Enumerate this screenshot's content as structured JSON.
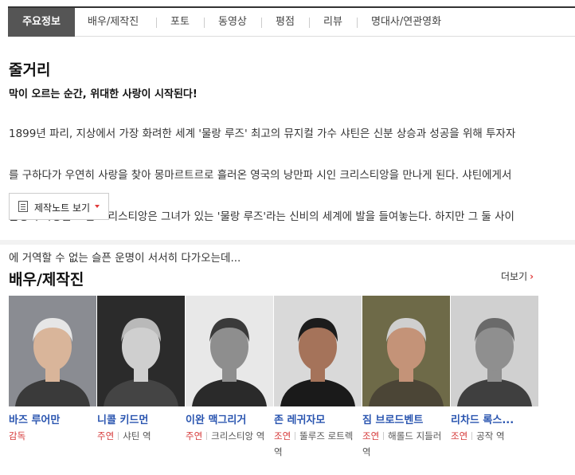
{
  "tabs": [
    "주요정보",
    "배우/제작진",
    "포토",
    "동영상",
    "평점",
    "리뷰",
    "명대사/연관영화"
  ],
  "synopsis": {
    "heading": "줄거리",
    "tagline": "막이 오르는 순간, 위대한 사랑이 시작된다!",
    "lines": [
      "1899년 파리, 지상에서 가장 화려한 세계 '물랑 루즈' 최고의 뮤지컬 가수 샤틴은 신분 상승과 성공을 위해 투자자",
      "를 구하다가 우연히 사랑을 찾아 몽마르트르로 흘러온 영국의 낭만파 시인 크리스티앙을 만나게 된다. 샤틴에게서",
      "운명적 사랑을 느낀 크리스티앙은 그녀가 있는 '물랑 루즈'라는 신비의 세계에 발을 들여놓는다. 하지만 그 둘 사이",
      "에 거역할 수 없는 슬픈 운명이 서서히 다가오는데..."
    ],
    "notes_button": "제작노트 보기"
  },
  "cast_section": {
    "heading": "배우/제작진",
    "more": "더보기"
  },
  "cast": [
    {
      "name": "바즈 루어만",
      "role_type": "감독",
      "role_name": "",
      "photo_icon": "portrait-icon",
      "bg": "#8a8c92",
      "skin": "#d9b59a",
      "hair": "#e6e6e6",
      "cloth": "#3a3a3a"
    },
    {
      "name": "니콜 키드먼",
      "role_type": "주연",
      "role_name": "샤틴 역",
      "photo_icon": "portrait-icon",
      "bg": "#2b2b2b",
      "skin": "#cfcfcf",
      "hair": "#b9b9b9",
      "cloth": "#444444"
    },
    {
      "name": "이완 맥그리거",
      "role_type": "주연",
      "role_name": "크리스티앙 역",
      "photo_icon": "portrait-icon",
      "bg": "#e8e8e8",
      "skin": "#8e8e8e",
      "hair": "#3a3a3a",
      "cloth": "#2a2a2a"
    },
    {
      "name": "존 레귀자모",
      "role_type": "조연",
      "role_name": "뚤루즈 로트렉 역",
      "photo_icon": "portrait-icon",
      "bg": "#d9d9d9",
      "skin": "#a5735a",
      "hair": "#1c1c1c",
      "cloth": "#1a1a1a"
    },
    {
      "name": "짐 브로드벤트",
      "role_type": "조연",
      "role_name": "해롤드 지들러 역",
      "photo_icon": "portrait-icon",
      "bg": "#6e6a48",
      "skin": "#c49378",
      "hair": "#cfcfcf",
      "cloth": "#4b4536"
    },
    {
      "name": "리차드 록스...",
      "role_type": "조연",
      "role_name": "공작 역",
      "photo_icon": "portrait-icon",
      "bg": "#d0d0d0",
      "skin": "#8f8f8f",
      "hair": "#6a6a6a",
      "cloth": "#3f3f3f"
    }
  ],
  "colors": {
    "accent_red": "#e13a3a",
    "link_blue": "#2a55b0",
    "tab_active": "#555555"
  }
}
